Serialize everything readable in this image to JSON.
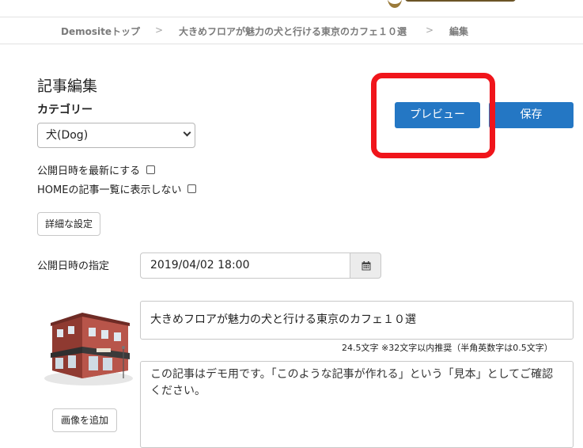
{
  "breadcrumb": {
    "items": [
      "Demositeトップ",
      "大きめフロアが魅力の犬と行ける東京のカフェ１０選",
      "編集"
    ],
    "separator": ">"
  },
  "page": {
    "title": "記事編集"
  },
  "category": {
    "label": "カテゴリー",
    "selected": "犬(Dog)"
  },
  "options": {
    "latest_date_label": "公開日時を最新にする",
    "hide_home_label": "HOMEの記事一覧に表示しない"
  },
  "buttons": {
    "details": "詳細な設定",
    "preview": "プレビュー",
    "save": "保存",
    "add_image": "画像を追加"
  },
  "publish": {
    "label": "公開日時の指定",
    "value": "2019/04/02 18:00"
  },
  "article": {
    "title": "大きめフロアが魅力の犬と行ける東京のカフェ１０選",
    "char_count": "24.5文字 ※32文字以内推奨（半角英数字は0.5文字）",
    "body": "この記事はデモ用です。「このような記事が作れる」という「見本」としてご確認ください。"
  },
  "colors": {
    "primary": "#2477c4",
    "highlight": "#f0151b"
  }
}
